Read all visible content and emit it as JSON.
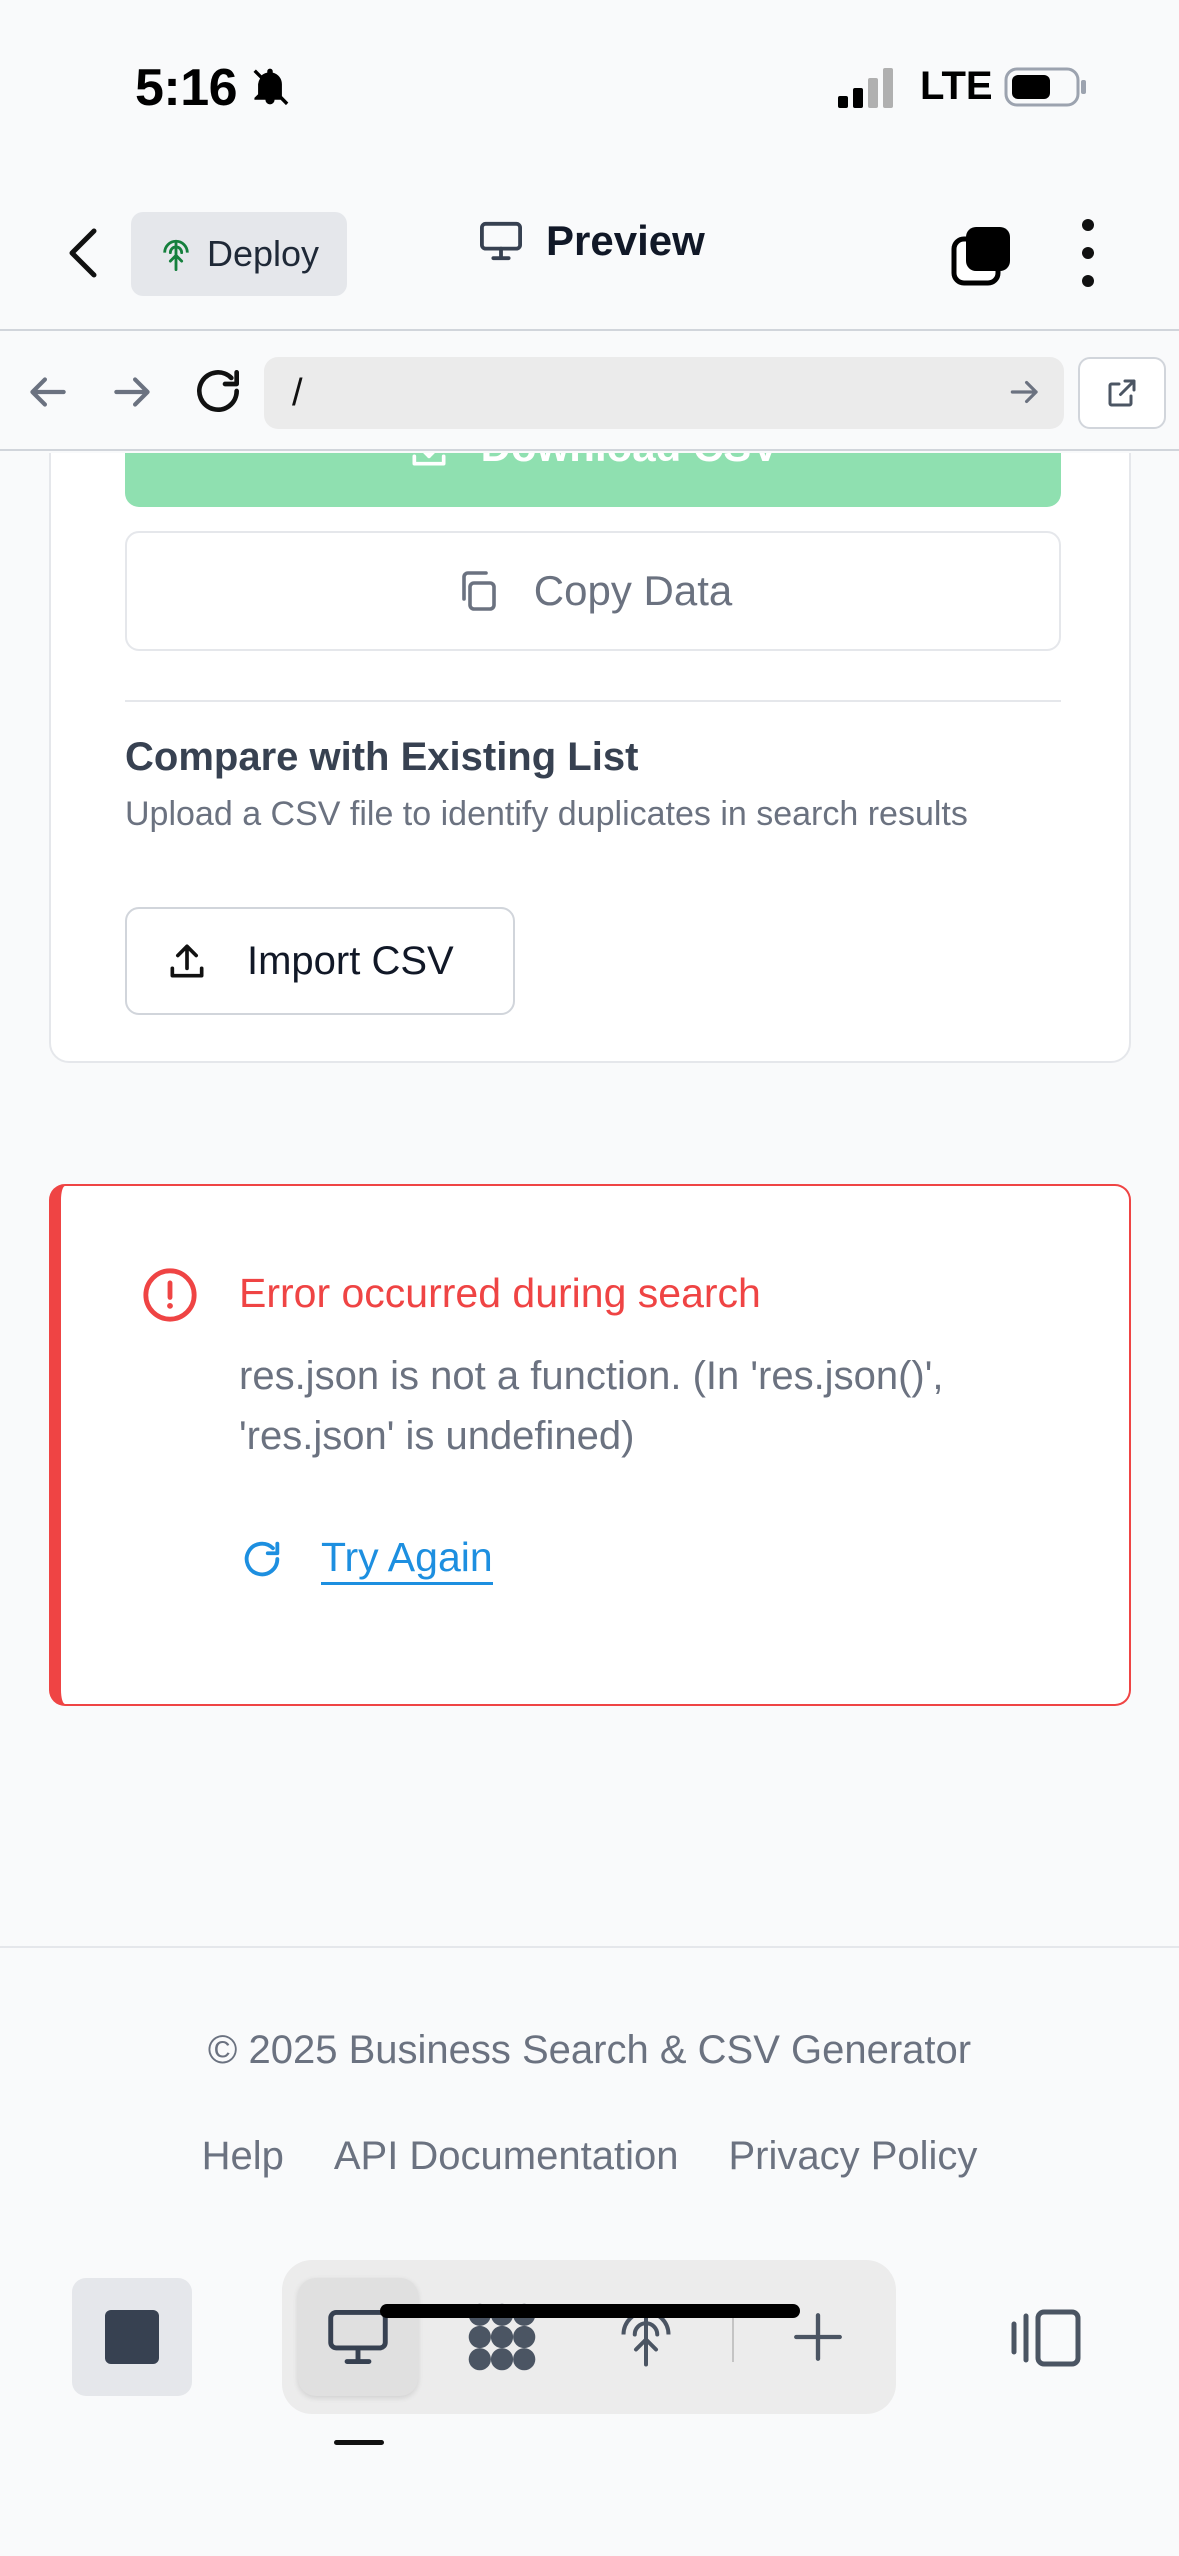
{
  "status_bar": {
    "time": "5:16",
    "network": "LTE"
  },
  "header": {
    "deploy_label": "Deploy",
    "preview_label": "Preview"
  },
  "browser": {
    "url": "/"
  },
  "card": {
    "download_label": "Download CSV",
    "copy_label": "Copy Data",
    "compare_title": "Compare with Existing List",
    "compare_description": "Upload a CSV file to identify duplicates in search results",
    "import_label": "Import CSV"
  },
  "error": {
    "title": "Error occurred during search",
    "message": "res.json is not a function. (In 'res.json()', 'res.json' is undefined)",
    "retry_label": "Try Again"
  },
  "footer": {
    "copyright": "© 2025 Business Search & CSV Generator",
    "links": [
      "Help",
      "API Documentation",
      "Privacy Policy"
    ]
  },
  "colors": {
    "error": "#ef4444",
    "link": "#1d8fe0",
    "success_faded": "#8fe0b0"
  },
  "icons": [
    "bell-slash-icon",
    "signal-icon",
    "battery-icon",
    "chevron-left-icon",
    "deploy-icon",
    "monitor-icon",
    "layers-icon",
    "kebab-icon",
    "arrow-left-icon",
    "arrow-right-icon",
    "reload-icon",
    "open-external-icon",
    "download-icon",
    "copy-icon",
    "upload-icon",
    "alert-circle-icon",
    "refresh-icon",
    "stop-icon",
    "dots-icon",
    "plus-icon",
    "panel-icon"
  ]
}
